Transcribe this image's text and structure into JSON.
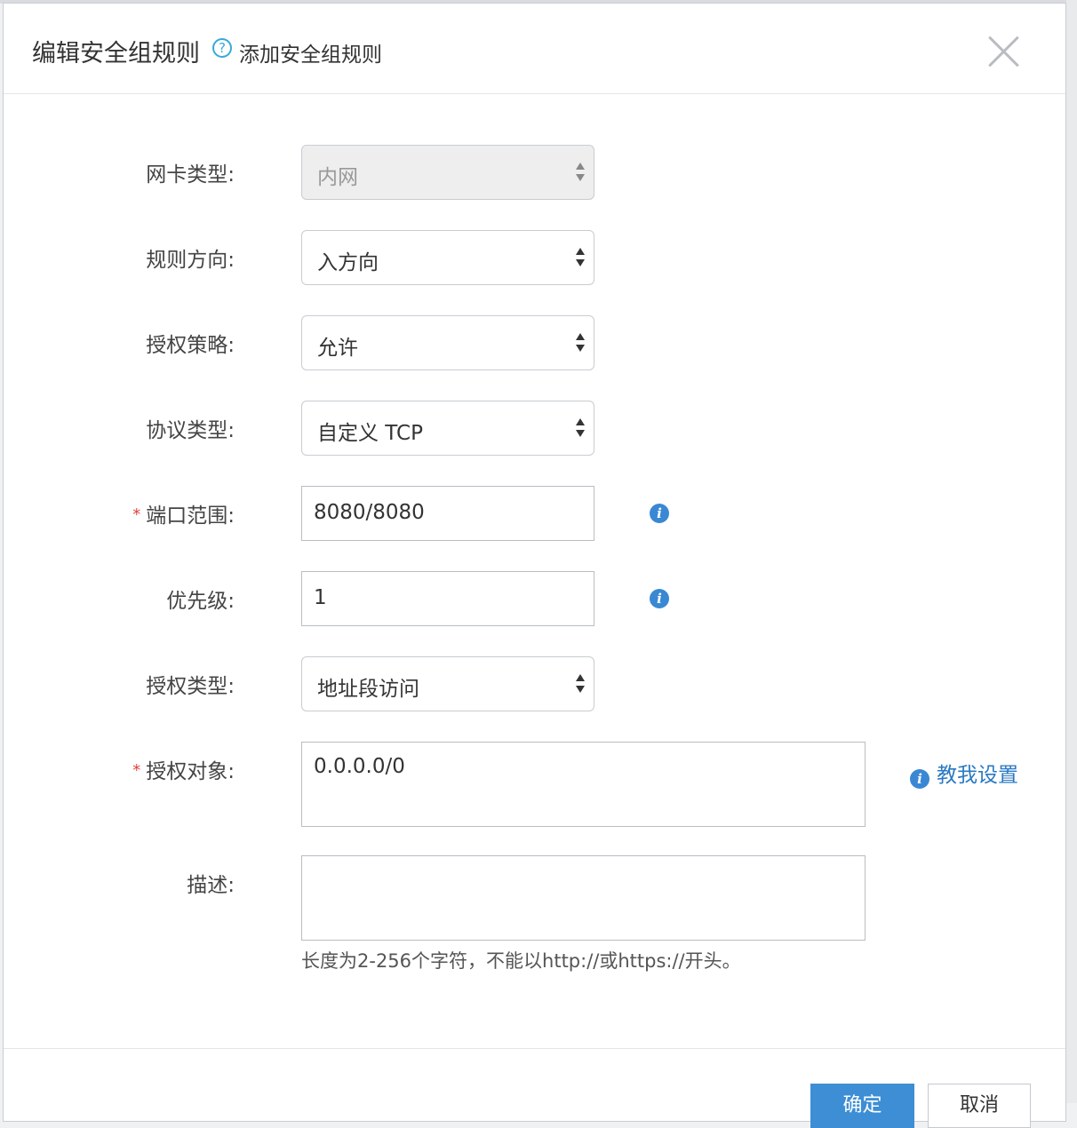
{
  "dialog": {
    "title": "编辑安全组规则",
    "subtitle_link": "添加安全组规则",
    "help_icon": "?"
  },
  "form": {
    "nic_type": {
      "label": "网卡类型:",
      "value": "内网",
      "disabled": true
    },
    "direction": {
      "label": "规则方向:",
      "value": "入方向"
    },
    "policy": {
      "label": "授权策略:",
      "value": "允许"
    },
    "protocol": {
      "label": "协议类型:",
      "value": "自定义 TCP"
    },
    "port_range": {
      "label": "端口范围:",
      "value": "8080/8080",
      "required": true
    },
    "priority": {
      "label": "优先级:",
      "value": "1"
    },
    "auth_type": {
      "label": "授权类型:",
      "value": "地址段访问"
    },
    "auth_object": {
      "label": "授权对象:",
      "value": "0.0.0.0/0",
      "required": true
    },
    "description": {
      "label": "描述:",
      "value": "",
      "hint": "长度为2-256个字符，不能以http://或https://开头。"
    }
  },
  "required_marker": "*",
  "info_icon_glyph": "i",
  "teach_link": "教我设置",
  "footer": {
    "ok_label": "确定",
    "cancel_label": "取消"
  },
  "colors": {
    "accent": "#3d8ed5",
    "link": "#2a79c2",
    "required": "#e0433b",
    "help": "#38a9d9"
  }
}
